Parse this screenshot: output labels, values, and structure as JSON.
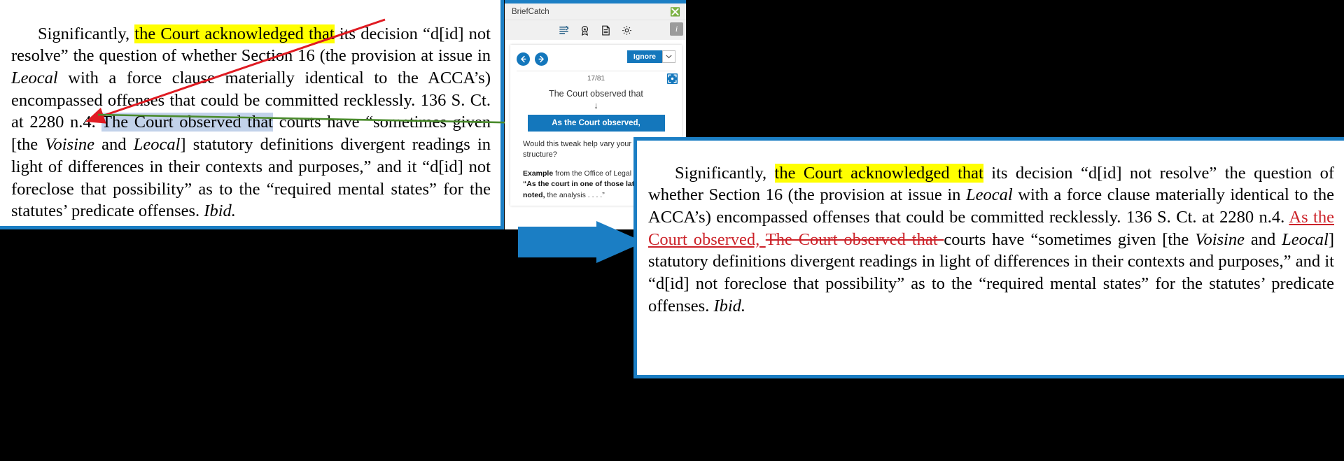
{
  "document_before": {
    "name": "original-brief-paragraph",
    "paragraph_runs": [
      {
        "text": "Significantly, ",
        "style": "plain"
      },
      {
        "text": "the Court acknowledged that",
        "style": "highlight-yellow"
      },
      {
        "text": " its decision “d[id] not resolve” the question of whether Section 16 (the provision at issue in ",
        "style": "plain"
      },
      {
        "text": "Leocal",
        "style": "italic"
      },
      {
        "text": " with a force clause materially identical to the ACCA’s) encompassed offenses that could be committed recklessly.  136 S. Ct. at 2280 n.4.  ",
        "style": "plain"
      },
      {
        "text": "The Court observed that",
        "style": "highlight-blue"
      },
      {
        "text": " courts have “sometimes given [the ",
        "style": "plain"
      },
      {
        "text": "Voisine",
        "style": "italic"
      },
      {
        "text": " and ",
        "style": "plain"
      },
      {
        "text": "Leocal",
        "style": "italic"
      },
      {
        "text": "] statutory definitions divergent readings in light of differences in their contexts and purposes,” and it “d[id] not foreclose that possibility” as to the “required mental states” for the statutes’ predicate offenses.  ",
        "style": "plain"
      },
      {
        "text": "Ibid.",
        "style": "italic"
      }
    ]
  },
  "briefcatch": {
    "title": "BriefCatch",
    "close_icon": "close-icon",
    "toolbar_icons": [
      {
        "name": "align-text-icon",
        "label": "Text alignment"
      },
      {
        "name": "award-ribbon-icon",
        "label": "Score"
      },
      {
        "name": "document-report-icon",
        "label": "Report"
      },
      {
        "name": "gear-icon",
        "label": "Settings"
      }
    ],
    "info_badge": "i",
    "nav": {
      "previous_icon": "arrow-left-icon",
      "next_icon": "arrow-right-icon"
    },
    "ignore_button": "Ignore",
    "ignore_caret_icon": "chevron-down-icon",
    "counter": "17/81",
    "expand_icon": "expand-icon",
    "original_text": "The Court observed that",
    "transform_arrow": "↓",
    "suggestion": "As the Court observed,",
    "question": "Would this tweak help vary your sentence structure?",
    "example_label": "Example",
    "example_source": " from the Office of Legal Counsel",
    "example_quote_bold_1": "“As the court in one of those later cases",
    "example_quote_bold_2": "noted,",
    "example_quote_rest": " the analysis . . . .”"
  },
  "document_after": {
    "name": "revised-brief-paragraph",
    "paragraph_runs": [
      {
        "text": "Significantly, ",
        "style": "plain"
      },
      {
        "text": "the Court acknowledged that",
        "style": "highlight-yellow"
      },
      {
        "text": " its decision “d[id] not resolve” the question of whether Section 16 (the provision at issue in ",
        "style": "plain"
      },
      {
        "text": "Leocal",
        "style": "italic"
      },
      {
        "text": " with a force clause materially identical to the ACCA’s) encompassed offenses that could be committed recklessly.  136 S. Ct. at 2280 n.4.  ",
        "style": "plain"
      },
      {
        "text": "As the Court observed, ",
        "style": "inserted"
      },
      {
        "text": "The Court observed that ",
        "style": "deleted"
      },
      {
        "text": "courts have “sometimes given [the ",
        "style": "plain"
      },
      {
        "text": "Voisine",
        "style": "italic"
      },
      {
        "text": " and ",
        "style": "plain"
      },
      {
        "text": "Leocal",
        "style": "italic"
      },
      {
        "text": "] statutory definitions divergent readings in light of differences in their contexts and purposes,” and it “d[id] not foreclose that possibility” as to the “required mental states” for the statutes’ predicate offenses.  ",
        "style": "plain"
      },
      {
        "text": "Ibid.",
        "style": "italic"
      }
    ]
  },
  "annotations": {
    "red_arrow": {
      "name": "red-annotation-arrow",
      "color": "#e01b22"
    },
    "green_arrow": {
      "name": "green-annotation-arrow",
      "color": "#4a8b2c"
    },
    "blue_flow_arrow": {
      "name": "blue-flow-arrow",
      "color": "#1b7ec4"
    }
  },
  "colors": {
    "accent_blue": "#1477bc",
    "frame_blue": "#1b7ec4",
    "highlight_yellow": "#ffff00",
    "highlight_blue": "#c2d2ea",
    "tracked_change_red": "#cc2229"
  }
}
